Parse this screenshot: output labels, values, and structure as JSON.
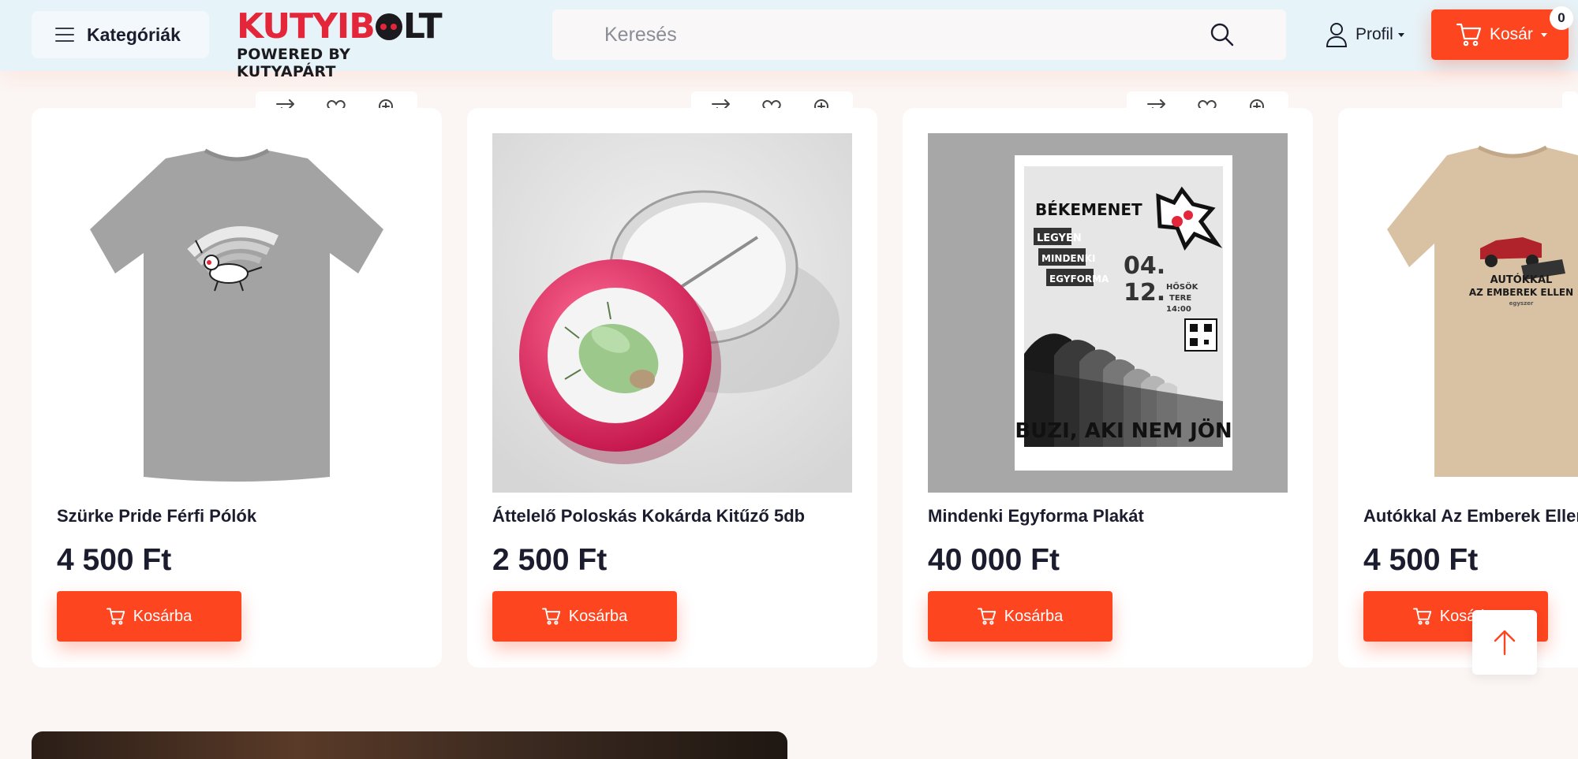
{
  "header": {
    "categories_label": "Kategóriák",
    "logo": {
      "main": "KUTYIBOLT",
      "sub": "POWERED BY KUTYAPÁRT"
    },
    "search": {
      "placeholder": "Keresés",
      "value": ""
    },
    "profile_label": "Profil",
    "cart_label": "Kosár",
    "cart_count": "0"
  },
  "colors": {
    "accent": "#fd4520",
    "header_bg": "#e6f3f8",
    "page_bg": "#fbf6f4",
    "text": "#1b1d2e",
    "logo_red": "#e3263a"
  },
  "products": [
    {
      "title": "Szürke Pride Férfi Pólók",
      "price": "4 500 Ft",
      "button": "Kosárba"
    },
    {
      "title": "Áttelelő Poloskás Kokárda Kitűző 5db",
      "price": "2 500 Ft",
      "button": "Kosárba"
    },
    {
      "title": "Mindenki Egyforma Plakát",
      "price": "40 000 Ft",
      "button": "Kosárba"
    },
    {
      "title": "Autókkal Az Emberek Ellen",
      "price": "4 500 Ft",
      "button": "Kosárba"
    }
  ],
  "poster": {
    "headline": "BÉKEMENET",
    "signs": [
      "LEGYEN",
      "MINDENKI",
      "EGYFORMA"
    ],
    "date": "04.",
    "date2": "12.",
    "place": "HŐSÖK",
    "place2": "TERE",
    "time": "14:00",
    "footer": "BUZI, AKI NEM JÖN"
  },
  "tshirt_print": {
    "line1": "AUTÓKKAL",
    "line2": "AZ EMBEREK ELLEN",
    "small": "egyszer"
  },
  "icons": [
    "menu-icon",
    "search-icon",
    "user-icon",
    "cart-icon",
    "compare-icon",
    "heart-icon",
    "zoom-icon",
    "arrow-up-icon"
  ]
}
